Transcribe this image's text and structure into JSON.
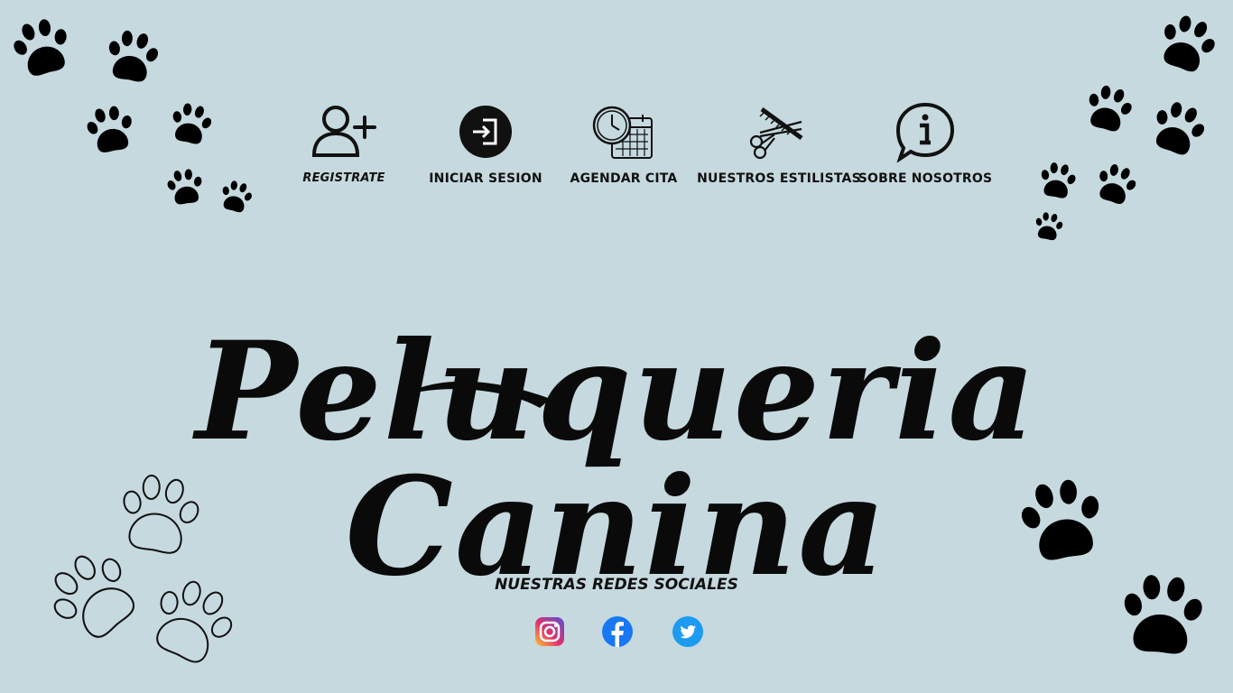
{
  "nav": {
    "items": [
      {
        "label": "REGISTRATE",
        "icon": "add-user-icon"
      },
      {
        "label": "INICIAR SESION",
        "icon": "login-icon"
      },
      {
        "label": "AGENDAR CITA",
        "icon": "clock-calendar-icon"
      },
      {
        "label": "NUESTROS ESTILISTAS",
        "icon": "scissors-comb-icon"
      },
      {
        "label": "SOBRE NOSOTROS",
        "icon": "info-chat-icon"
      }
    ]
  },
  "brand": {
    "title": "Peluqueria Canina"
  },
  "social": {
    "title": "NUESTRAS REDES SOCIALES",
    "links": [
      {
        "name": "instagram-icon"
      },
      {
        "name": "facebook-icon"
      },
      {
        "name": "twitter-icon"
      }
    ]
  },
  "colors": {
    "background": "#c5d9df",
    "ink": "#0a0a0a",
    "facebook": "#1877f2",
    "twitter": "#1d9bf0"
  }
}
